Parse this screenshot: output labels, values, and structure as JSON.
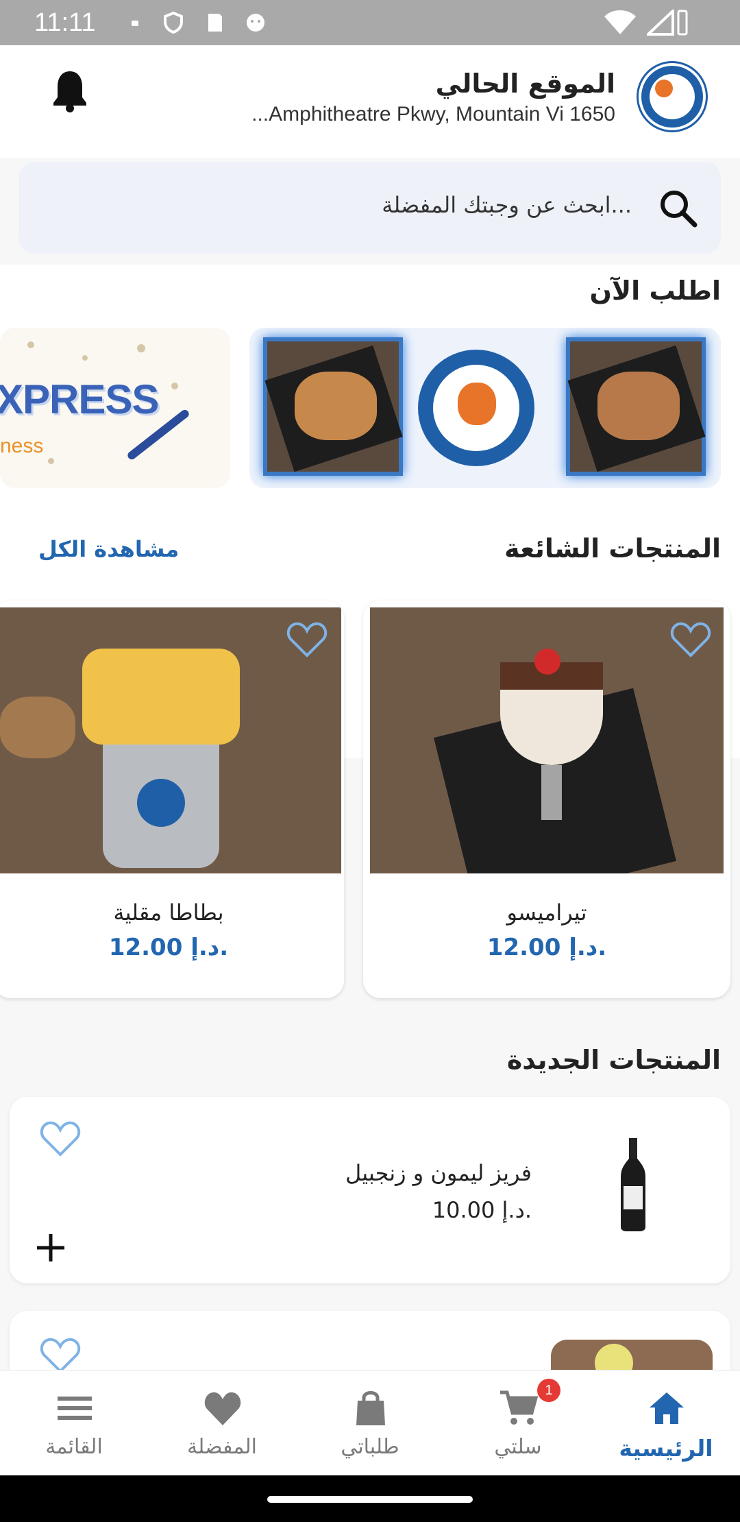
{
  "status_bar": {
    "time": "11:11"
  },
  "header": {
    "title": "الموقع الحالي",
    "address": "...Amphitheatre Pkwy, Mountain Vi 1650"
  },
  "search": {
    "placeholder": "ابحث عن وجبتك المفضلة..."
  },
  "sections": {
    "order_now": "اطلب الآن",
    "popular": "المنتجات الشائعة",
    "see_all": "مشاهدة الكل",
    "new_products": "المنتجات الجديدة"
  },
  "banners": [
    {
      "text": "XPRESS",
      "subtext": "ness"
    }
  ],
  "popular_products": [
    {
      "name": "تيراميسو",
      "price": "12.00 د.إ."
    },
    {
      "name": "بطاطا مقلية",
      "price": "12.00 د.إ."
    }
  ],
  "new_products": [
    {
      "name": "فريز ليمون و زنجبيل",
      "price": "10.00 د.إ."
    }
  ],
  "nav": {
    "home": "الرئيسية",
    "cart": "سلتي",
    "cart_badge": "1",
    "orders": "طلباتي",
    "favorites": "المفضلة",
    "menu": "القائمة"
  },
  "colors": {
    "accent": "#2266b0",
    "badge": "#e53935"
  }
}
